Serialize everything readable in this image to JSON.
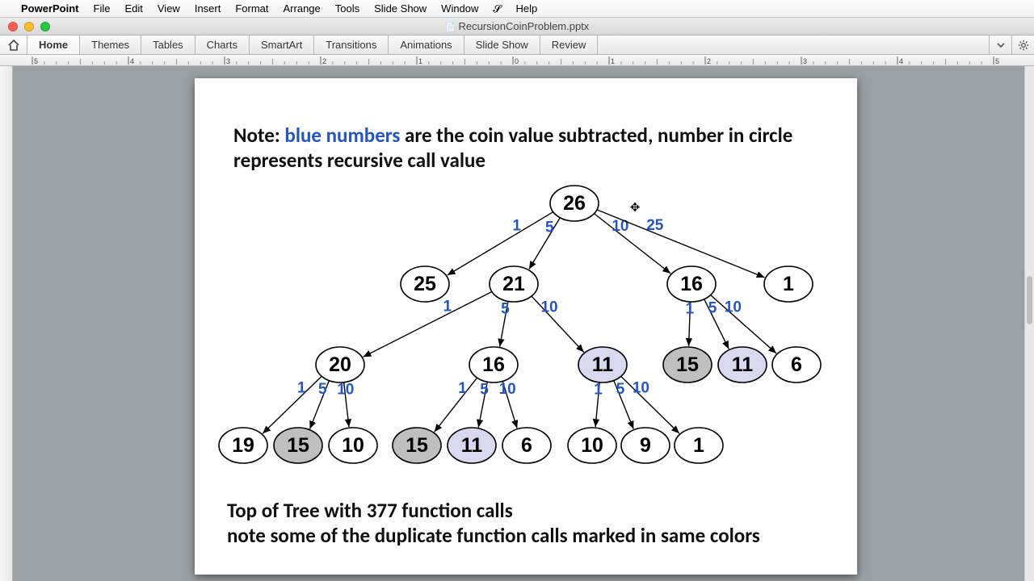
{
  "menubar": {
    "app": "PowerPoint",
    "items": [
      "File",
      "Edit",
      "View",
      "Insert",
      "Format",
      "Arrange",
      "Tools",
      "Slide Show",
      "Window",
      "Help"
    ]
  },
  "window": {
    "title": "RecursionCoinProblem.pptx"
  },
  "ribbon": {
    "tabs": [
      "Home",
      "Themes",
      "Tables",
      "Charts",
      "SmartArt",
      "Transitions",
      "Animations",
      "Slide Show",
      "Review"
    ]
  },
  "ruler": {
    "labels": [
      "5",
      "4",
      "3",
      "2",
      "1",
      "0",
      "1",
      "2",
      "3",
      "4",
      "5"
    ]
  },
  "slide": {
    "note_prefix": "Note: ",
    "note_blue": "blue numbers",
    "note_rest": " are the coin value subtracted, number in circle represents recursive call value",
    "footer_line1": "Top of Tree with 377 function calls",
    "footer_line2": "note some of the duplicate function calls marked in same colors"
  },
  "chart_data": {
    "type": "tree",
    "description": "Recursion tree for the coin-change problem starting at 26, edge labels are coin values subtracted (1,5,10,25), node values are remaining amount. Shaded nodes mark duplicate recursive calls.",
    "coin_values": [
      1,
      5,
      10,
      25
    ],
    "node_styles": {
      "plain": "white",
      "gray": "duplicate-dark",
      "lav": "duplicate-light"
    },
    "nodes": [
      {
        "id": "n26",
        "v": 26,
        "style": "plain"
      },
      {
        "id": "n25",
        "v": 25,
        "style": "plain"
      },
      {
        "id": "n21",
        "v": 21,
        "style": "plain"
      },
      {
        "id": "n16a",
        "v": 16,
        "style": "plain"
      },
      {
        "id": "n1a",
        "v": 1,
        "style": "plain"
      },
      {
        "id": "n20",
        "v": 20,
        "style": "plain"
      },
      {
        "id": "n16b",
        "v": 16,
        "style": "plain"
      },
      {
        "id": "n11a",
        "v": 11,
        "style": "lav"
      },
      {
        "id": "n15a",
        "v": 15,
        "style": "gray"
      },
      {
        "id": "n11b",
        "v": 11,
        "style": "lav"
      },
      {
        "id": "n6a",
        "v": 6,
        "style": "plain"
      },
      {
        "id": "n19",
        "v": 19,
        "style": "plain"
      },
      {
        "id": "n15b",
        "v": 15,
        "style": "gray"
      },
      {
        "id": "n10a",
        "v": 10,
        "style": "plain"
      },
      {
        "id": "n15c",
        "v": 15,
        "style": "gray"
      },
      {
        "id": "n11c",
        "v": 11,
        "style": "lav"
      },
      {
        "id": "n6b",
        "v": 6,
        "style": "plain"
      },
      {
        "id": "n10b",
        "v": 10,
        "style": "plain"
      },
      {
        "id": "n9",
        "v": 9,
        "style": "plain"
      },
      {
        "id": "n1b",
        "v": 1,
        "style": "plain"
      }
    ],
    "edges": [
      {
        "from": "n26",
        "to": "n25",
        "label": 1
      },
      {
        "from": "n26",
        "to": "n21",
        "label": 5
      },
      {
        "from": "n26",
        "to": "n16a",
        "label": 10
      },
      {
        "from": "n26",
        "to": "n1a",
        "label": 25
      },
      {
        "from": "n21",
        "to": "n20",
        "label": 1
      },
      {
        "from": "n21",
        "to": "n16b",
        "label": 5
      },
      {
        "from": "n21",
        "to": "n11a",
        "label": 10
      },
      {
        "from": "n16a",
        "to": "n15a",
        "label": 1
      },
      {
        "from": "n16a",
        "to": "n11b",
        "label": 5
      },
      {
        "from": "n16a",
        "to": "n6a",
        "label": 10
      },
      {
        "from": "n20",
        "to": "n19",
        "label": 1
      },
      {
        "from": "n20",
        "to": "n15b",
        "label": 5
      },
      {
        "from": "n20",
        "to": "n10a",
        "label": 10
      },
      {
        "from": "n16b",
        "to": "n15c",
        "label": 1
      },
      {
        "from": "n16b",
        "to": "n11c",
        "label": 5
      },
      {
        "from": "n16b",
        "to": "n6b",
        "label": 10
      },
      {
        "from": "n11a",
        "to": "n10b",
        "label": 1
      },
      {
        "from": "n11a",
        "to": "n9",
        "label": 5
      },
      {
        "from": "n11a",
        "to": "n1b",
        "label": 10
      }
    ]
  }
}
